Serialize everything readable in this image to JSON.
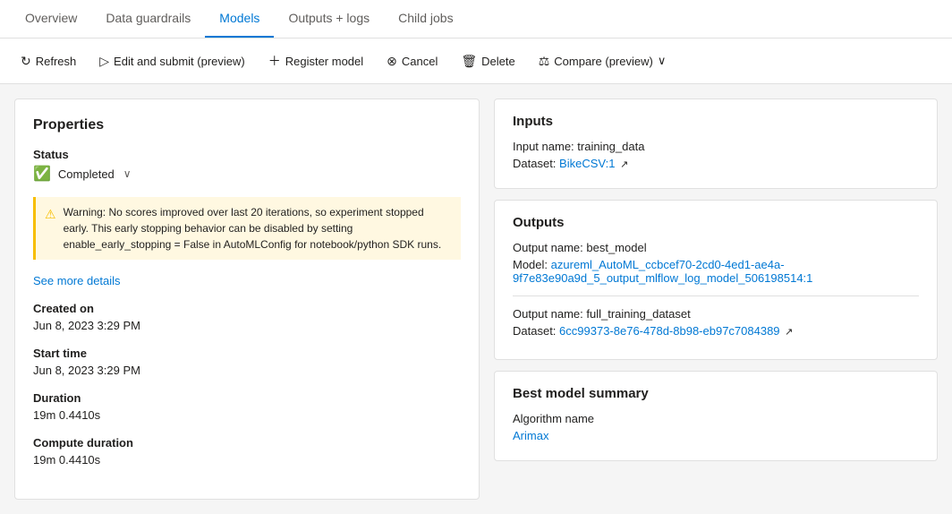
{
  "tabs": [
    {
      "id": "overview",
      "label": "Overview",
      "active": false
    },
    {
      "id": "data-guardrails",
      "label": "Data guardrails",
      "active": false
    },
    {
      "id": "models",
      "label": "Models",
      "active": true
    },
    {
      "id": "outputs-logs",
      "label": "Outputs + logs",
      "active": false
    },
    {
      "id": "child-jobs",
      "label": "Child jobs",
      "active": false
    }
  ],
  "toolbar": {
    "refresh_label": "Refresh",
    "edit_submit_label": "Edit and submit (preview)",
    "register_model_label": "Register model",
    "cancel_label": "Cancel",
    "delete_label": "Delete",
    "compare_label": "Compare (preview)"
  },
  "left_panel": {
    "title": "Properties",
    "status_label": "Status",
    "status_value": "Completed",
    "warning_text": "Warning: No scores improved over last 20 iterations, so experiment stopped early. This early stopping behavior can be disabled by setting enable_early_stopping = False in AutoMLConfig for notebook/python SDK runs.",
    "see_more_label": "See more details",
    "created_on_label": "Created on",
    "created_on_value": "Jun 8, 2023 3:29 PM",
    "start_time_label": "Start time",
    "start_time_value": "Jun 8, 2023 3:29 PM",
    "duration_label": "Duration",
    "duration_value": "19m 0.4410s",
    "compute_duration_label": "Compute duration",
    "compute_duration_value": "19m 0.4410s"
  },
  "inputs_card": {
    "title": "Inputs",
    "input_name_label": "Input name: training_data",
    "dataset_label": "Dataset:",
    "dataset_link": "BikeCSV:1",
    "dataset_link_icon": "↗"
  },
  "outputs_card": {
    "title": "Outputs",
    "output1_name": "Output name: best_model",
    "model_label": "Model:",
    "model_link": "azureml_AutoML_ccbcef70-2cd0-4ed1-ae4a-9f7e83e90a9d_5_output_mlflow_log_model_506198514:1",
    "output2_name": "Output name: full_training_dataset",
    "dataset2_label": "Dataset:",
    "dataset2_link": "6cc99373-8e76-478d-8b98-eb97c7084389",
    "dataset2_icon": "↗"
  },
  "best_model_card": {
    "title": "Best model summary",
    "algorithm_name_label": "Algorithm name",
    "algorithm_link": "Arimax"
  }
}
